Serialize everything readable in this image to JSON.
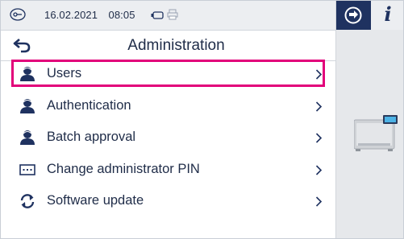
{
  "status": {
    "date": "16.02.2021",
    "time": "08:05",
    "icons": [
      "key-lock-icon",
      "usb-stick-icon",
      "printer-icon"
    ]
  },
  "title": "Administration",
  "menu": {
    "items": [
      {
        "label": "Users",
        "icon": "user-icon",
        "selected": true
      },
      {
        "label": "Authentication",
        "icon": "user-icon",
        "selected": false
      },
      {
        "label": "Batch approval",
        "icon": "user-icon",
        "selected": false
      },
      {
        "label": "Change administrator PIN",
        "icon": "pin-keypad-icon",
        "selected": false
      },
      {
        "label": "Software update",
        "icon": "refresh-icon",
        "selected": false
      }
    ]
  },
  "rightpanel": {
    "info_label": "i"
  },
  "colors": {
    "accent_navy": "#1f3260",
    "highlight_magenta": "#e2007a",
    "statusbar_bg": "#eceef1"
  }
}
